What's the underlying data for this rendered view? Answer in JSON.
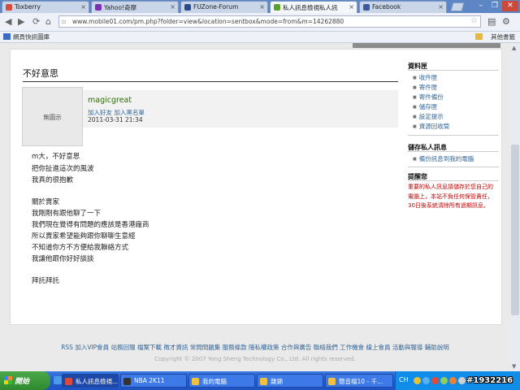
{
  "browser": {
    "tabs": [
      {
        "label": "Toxberry",
        "color": "#d94a3b",
        "active": false
      },
      {
        "label": "Yahoo!奇摩",
        "color": "#7b2fb5",
        "active": false
      },
      {
        "label": "FUZone-Forum",
        "color": "#2c4a8a",
        "active": false
      },
      {
        "label": "私人訊息檢視私人訊",
        "color": "#5aa02c",
        "active": true
      },
      {
        "label": "Facebook",
        "color": "#3b5998",
        "active": false
      }
    ],
    "url": "www.mobile01.com/pm.php?folder=view&location=sentbox&mode=from&m=14262880",
    "bookmark_label": "網頁快訊圖庫",
    "other_bookmarks": "其他書籤"
  },
  "message": {
    "title": "不好意思",
    "avatar_placeholder": "無圖示",
    "username": "magicgreat",
    "user_links": "加入好友  加入黑名單",
    "date": "2011-03-31 21:34",
    "lines": [
      "m大，不好意思",
      "把你扯進這次的風波",
      "我真的很抱歉",
      "",
      "關於賣家",
      "我剛剛有跟他聊了一下",
      "我們現在覺得有問題的應該是香港廠商",
      "所以賣家希望能夠跟你聊聊生意經",
      "不知道你方不方便給我聯絡方式",
      "我讓他跟你好好談談",
      "",
      "拜託拜託"
    ]
  },
  "sidebar": {
    "folders_title": "資料匣",
    "folders": [
      "收件匣",
      "寄件匣",
      "寄件備份",
      "儲存匣",
      "設定提示",
      "資源回收筒"
    ],
    "save_title": "儲存私人訊息",
    "save_items": [
      "備份訊息到我的電腦"
    ],
    "reminder_title": "提醒您",
    "reminder_text": "重要的私人訊息請儲存於您自己的電腦上，本站不負任何保管責任，30日後系統清除所有過期訊息。"
  },
  "footer": {
    "links": "RSS  加入VIP會員  站務回報  檔案下載  徵才資訊  常問問題集  服務條款  隱私權政策  合作與廣告  聯絡我們  工作機會  線上會員  活動與報導  輔助說明",
    "copyright": "Copyright © 2007 Yong Sheng Technology Co., Ltd. All rights reserved."
  },
  "taskbar": {
    "start_label": "開始",
    "tasks": [
      {
        "label": "私人訊息檢視...",
        "color": "#d94a3b",
        "active": true
      },
      {
        "label": "NBA 2K11",
        "color": "#333333",
        "active": false
      },
      {
        "label": "我的電腦",
        "color": "#f0c040",
        "active": false
      },
      {
        "label": "雜錦",
        "color": "#f0c040",
        "active": false
      },
      {
        "label": "簡音檔10 - 千...",
        "color": "#f0c040",
        "active": false
      }
    ],
    "lang": "CH",
    "watermark": "#1932216"
  }
}
